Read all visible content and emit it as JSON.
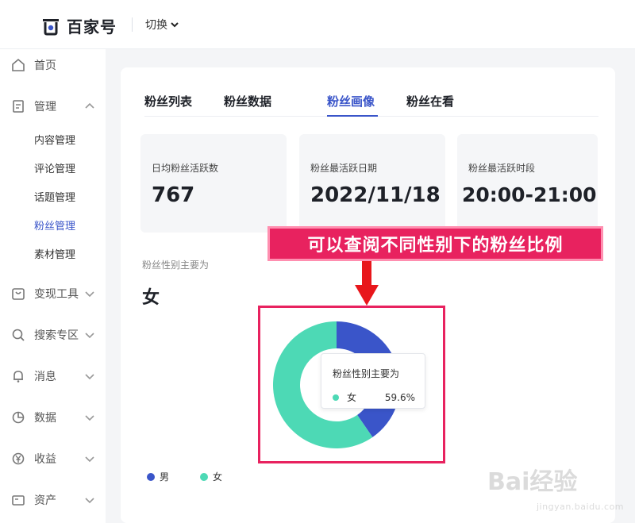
{
  "header": {
    "brand": "百家号",
    "switch_label": "切换"
  },
  "sidebar": {
    "home": "首页",
    "manage": "管理",
    "sub_items": [
      "内容管理",
      "评论管理",
      "话题管理",
      "粉丝管理",
      "素材管理"
    ],
    "active_sub": "粉丝管理",
    "items": [
      "变现工具",
      "搜索专区",
      "消息",
      "数据",
      "收益",
      "资产"
    ]
  },
  "tabs": [
    "粉丝列表",
    "粉丝数据",
    "粉丝画像",
    "粉丝在看"
  ],
  "active_tab": "粉丝画像",
  "stats": [
    {
      "title": "日均粉丝活跃数",
      "value": "767"
    },
    {
      "title": "粉丝最活跃日期",
      "value": "2022/11/18"
    },
    {
      "title": "粉丝最活跃时段",
      "value": "20:00-21:00"
    }
  ],
  "gender": {
    "title": "粉丝性别主要为",
    "main": "女"
  },
  "chart_data": {
    "type": "pie",
    "categories": [
      "男",
      "女"
    ],
    "values": [
      40.4,
      59.6
    ],
    "colors": [
      "#3a55c9",
      "#4dd9b5"
    ],
    "legend_position": "bottom-left"
  },
  "tooltip": {
    "title": "粉丝性别主要为",
    "label": "女",
    "value": "59.6%"
  },
  "annotation": {
    "text": "可以查阅不同性别下的粉丝比例"
  },
  "watermark": {
    "big": "Bai经验",
    "small": "jingyan.baidu.com"
  }
}
